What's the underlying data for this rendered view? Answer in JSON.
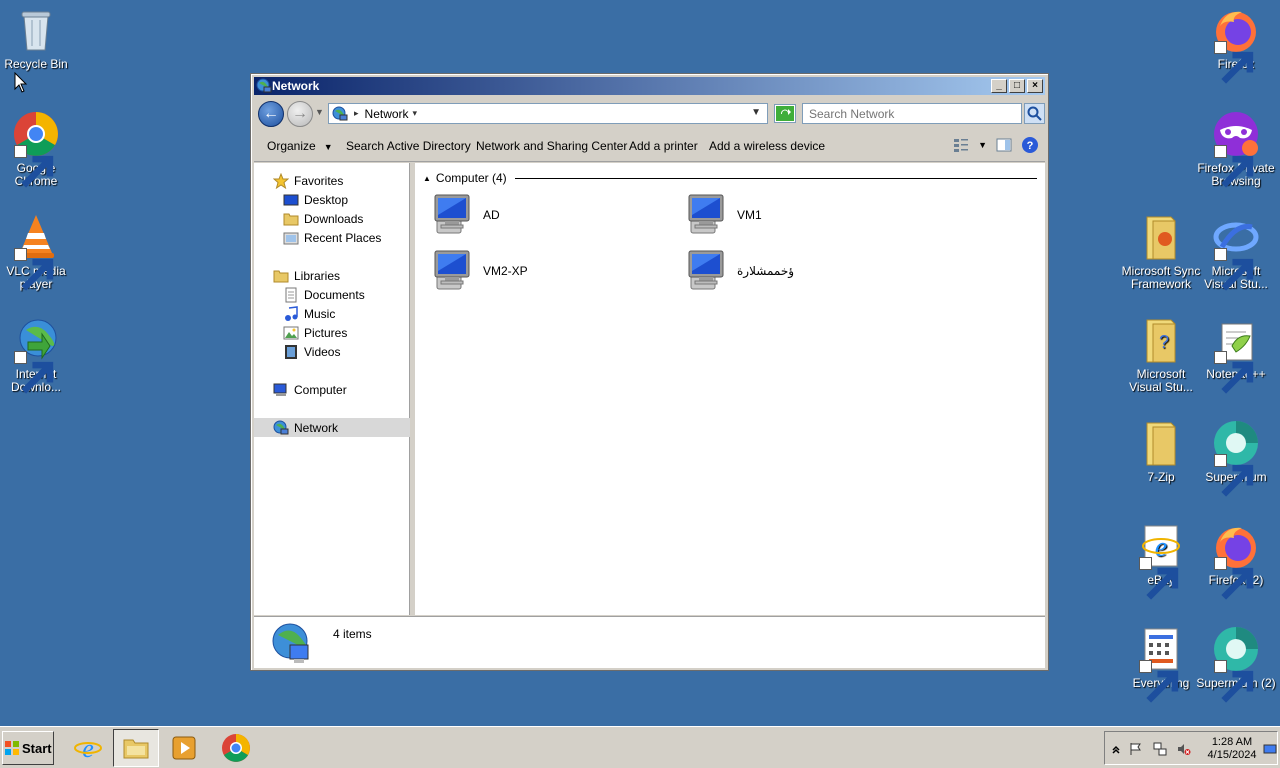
{
  "desktop": {
    "left_icons": [
      {
        "label": "Recycle Bin",
        "icon": "recycle-bin-icon"
      },
      {
        "label": "Google Chrome",
        "icon": "chrome-icon"
      },
      {
        "label": "VLC media player",
        "icon": "vlc-icon"
      },
      {
        "label": "Internet Downlo...",
        "icon": "internet-download-manager-icon"
      }
    ],
    "right_icons": [
      {
        "label": "Firefox",
        "icon": "firefox-icon"
      },
      {
        "label": "Firefox Private Browsing",
        "icon": "firefox-private-icon"
      },
      {
        "label": "Microsoft Sync Framework",
        "icon": "folder-icon"
      },
      {
        "label": "Microsoft Visual Stu...",
        "icon": "visual-studio-icon"
      },
      {
        "label": "Microsoft Visual Stu...",
        "icon": "folder-icon"
      },
      {
        "label": "Notepad++",
        "icon": "notepadpp-icon"
      },
      {
        "label": "7-Zip",
        "icon": "folder-icon"
      },
      {
        "label": "Supermium",
        "icon": "supermium-icon"
      },
      {
        "label": "eBay",
        "icon": "ie-icon"
      },
      {
        "label": "Firefox (2)",
        "icon": "firefox-icon"
      },
      {
        "label": "Everything",
        "icon": "everything-icon"
      },
      {
        "label": "Supermium (2)",
        "icon": "supermium-icon"
      }
    ]
  },
  "window": {
    "title": "Network",
    "address": {
      "crumb": "Network"
    },
    "search": {
      "placeholder": "Search Network"
    },
    "commands": {
      "organize": "Organize",
      "search_ad": "Search Active Directory",
      "network_sharing": "Network and Sharing Center",
      "add_printer": "Add a printer",
      "add_wireless": "Add a wireless device"
    },
    "nav": {
      "favorites": "Favorites",
      "desktop": "Desktop",
      "downloads": "Downloads",
      "recent_places": "Recent Places",
      "libraries": "Libraries",
      "documents": "Documents",
      "music": "Music",
      "pictures": "Pictures",
      "videos": "Videos",
      "computer": "Computer",
      "network": "Network"
    },
    "group_header": "Computer (4)",
    "computers": [
      "AD",
      "VM1",
      "VM2-XP",
      "ؤخممشلارة"
    ],
    "status": "4 items"
  },
  "taskbar": {
    "start_label": "Start",
    "time": "1:28 AM",
    "date": "4/15/2024"
  },
  "colors": {
    "desktop_bg": "#3a6ea5",
    "titlebar_start": "#0a246a",
    "titlebar_end": "#a6caf0"
  }
}
